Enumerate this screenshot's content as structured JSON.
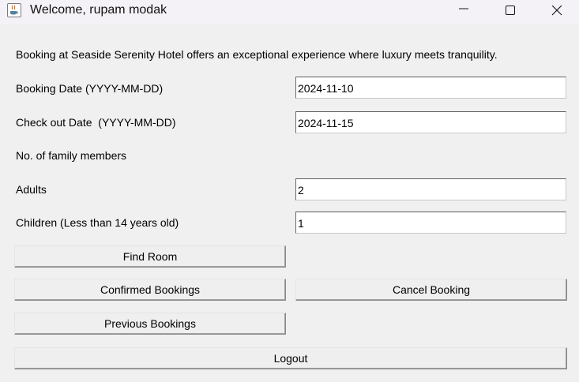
{
  "window": {
    "title": "Welcome, rupam modak",
    "icons": {
      "app": "java-coffee-cup-icon",
      "minimize": "minimize-icon",
      "maximize": "maximize-icon",
      "close": "close-icon"
    }
  },
  "form": {
    "intro": "Booking at Seaside Serenity Hotel offers an exceptional experience where luxury meets tranquility.",
    "booking_date_label": "Booking Date (YYYY-MM-DD)",
    "booking_date_value": "2024-11-10",
    "checkout_date_label": "Check out Date  (YYYY-MM-DD)",
    "checkout_date_value": "2024-11-15",
    "family_members_label": "No. of family members",
    "adults_label": "Adults",
    "adults_value": "2",
    "children_label": "Children (Less than 14 years old)",
    "children_value": "1"
  },
  "buttons": {
    "find_room": "Find Room",
    "confirmed_bookings": "Confirmed Bookings",
    "cancel_booking": "Cancel Booking",
    "previous_bookings": "Previous Bookings",
    "logout": "Logout"
  }
}
